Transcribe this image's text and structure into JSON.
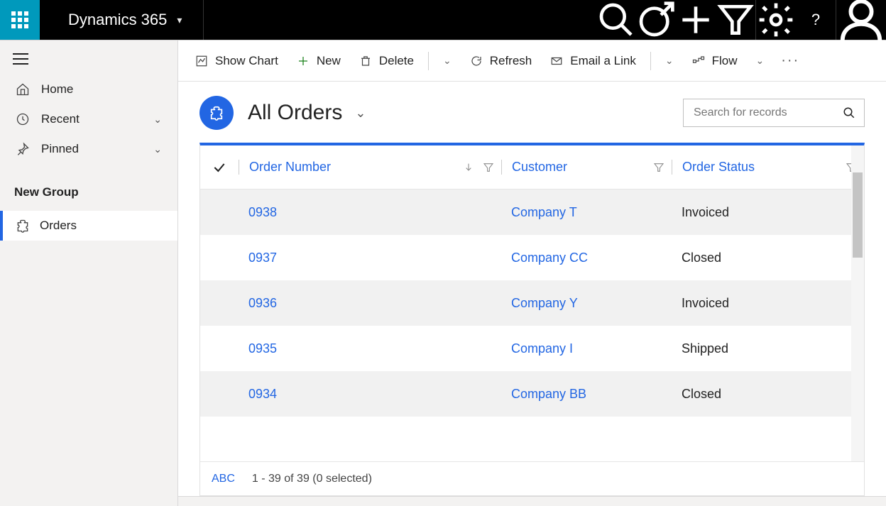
{
  "header": {
    "brand": "Dynamics 365"
  },
  "sidebar": {
    "items": [
      {
        "label": "Home"
      },
      {
        "label": "Recent"
      },
      {
        "label": "Pinned"
      }
    ],
    "group_label": "New Group",
    "active_item": "Orders"
  },
  "cmdbar": {
    "show_chart": "Show Chart",
    "new": "New",
    "delete": "Delete",
    "refresh": "Refresh",
    "email_link": "Email a Link",
    "flow": "Flow"
  },
  "page": {
    "title": "All Orders",
    "search_placeholder": "Search for records"
  },
  "grid": {
    "columns": {
      "order_number": "Order Number",
      "customer": "Customer",
      "order_status": "Order Status"
    },
    "rows": [
      {
        "order_number": "0938",
        "customer": "Company T",
        "order_status": "Invoiced"
      },
      {
        "order_number": "0937",
        "customer": "Company CC",
        "order_status": "Closed"
      },
      {
        "order_number": "0936",
        "customer": "Company Y",
        "order_status": "Invoiced"
      },
      {
        "order_number": "0935",
        "customer": "Company I",
        "order_status": "Shipped"
      },
      {
        "order_number": "0934",
        "customer": "Company BB",
        "order_status": "Closed"
      }
    ],
    "footer": {
      "abc": "ABC",
      "count": "1 - 39 of 39 (0 selected)"
    }
  },
  "colors": {
    "accent": "#2266e3",
    "waffle": "#0099bc"
  }
}
